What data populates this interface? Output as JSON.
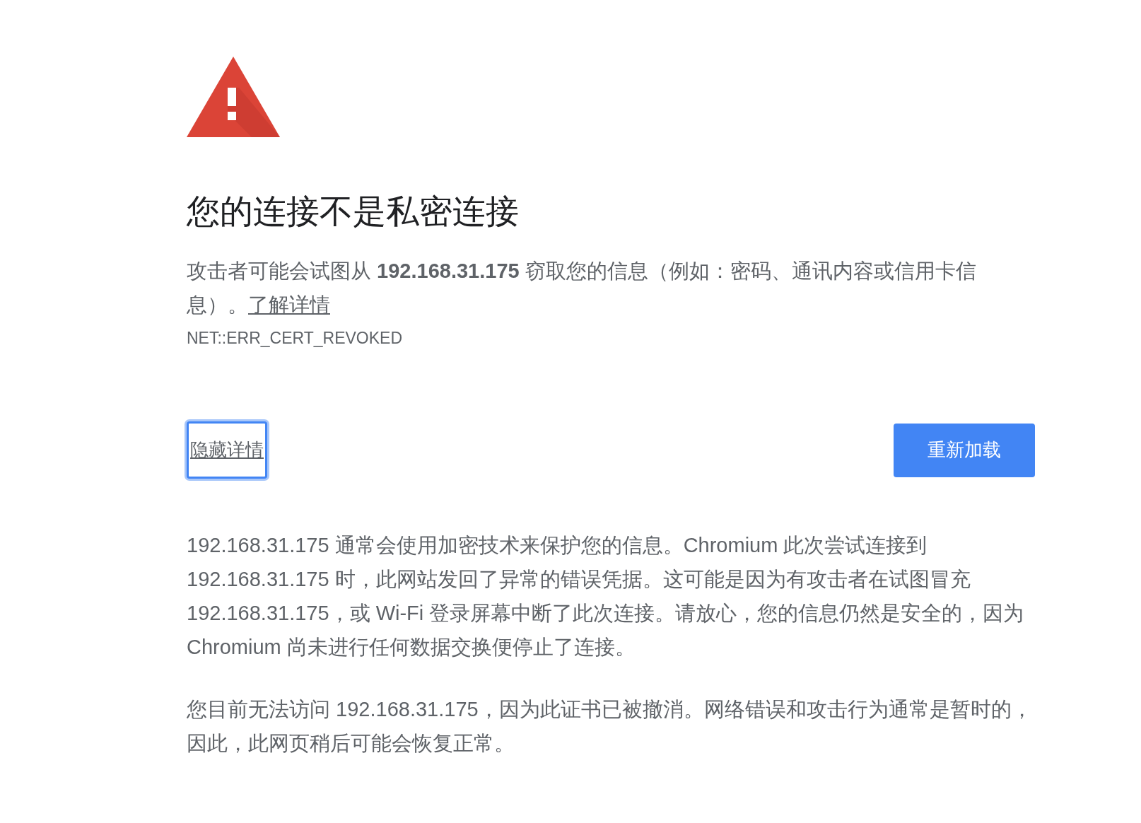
{
  "heading": {
    "title": "您的连接不是私密连接"
  },
  "intro": {
    "text": "攻击者可能会试图从 **192.168.31.175** 窃取您的信息（例如：密码、通讯内容或信用卡信息）。",
    "link": "了解详情"
  },
  "error_code": "NET::ERR_CERT_REVOKED",
  "buttons": [
    {
      "kind": "link",
      "label": "隐藏详情",
      "focused": true
    },
    {
      "kind": "primary",
      "label": "重新加载",
      "focused": false
    }
  ],
  "details": [
    {
      "text": "192.168.31.175 通常会使用加密技术来保护您的信息。Chromium 此次尝试连接到 192.168.31.175 时，此网站发回了异常的错误凭据。这可能是因为有攻击者在试图冒充 192.168.31.175，或 Wi-Fi 登录屏幕中断了此次连接。请放心，您的信息仍然是安全的，因为 Chromium 尚未进行任何数据交换便停止了连接。"
    },
    {
      "text": "您目前无法访问 192.168.31.175，因为此证书已被撤消。网络错误和攻击行为通常是暂时的，因此，此网页稍后可能会恢复正常。"
    }
  ]
}
